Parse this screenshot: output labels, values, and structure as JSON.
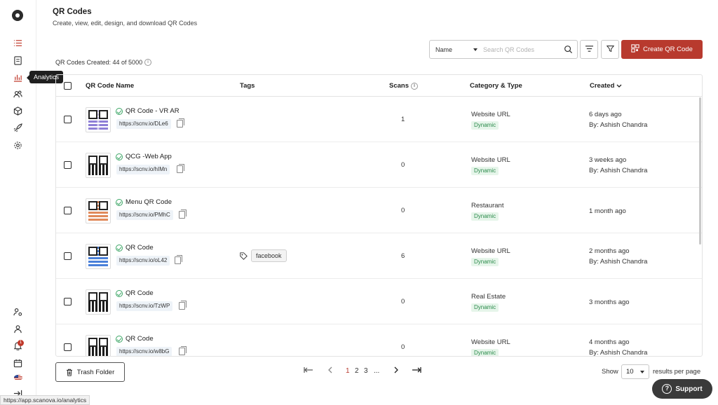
{
  "header": {
    "title": "QR Codes",
    "subtitle": "Create, view, edit, design, and download QR Codes",
    "counter": "QR Codes Created: 44 of 5000"
  },
  "sidebar": {
    "tooltip": "Analytics",
    "notification_count": "1"
  },
  "toolbar": {
    "filter_select_value": "Name",
    "search_placeholder": "Search QR Codes",
    "create_label": "Create QR Code"
  },
  "table": {
    "headers": {
      "name": "QR Code Name",
      "tags": "Tags",
      "scans": "Scans",
      "category": "Category & Type",
      "created": "Created"
    },
    "rows": [
      {
        "name": "QR Code - VR AR",
        "url": "https://scnv.io/DLe6",
        "tag": "",
        "scans": "1",
        "category": "Website URL",
        "type": "Dynamic",
        "created": "6 days ago",
        "by": "By: Ashish Chandra",
        "qr_style": "color"
      },
      {
        "name": "QCG -Web App",
        "url": "https://scnv.io/hIMn",
        "tag": "",
        "scans": "0",
        "category": "Website URL",
        "type": "Dynamic",
        "created": "3 weeks ago",
        "by": "By: Ashish Chandra",
        "qr_style": "bw"
      },
      {
        "name": "Menu QR Code",
        "url": "https://scnv.io/PMhC",
        "tag": "",
        "scans": "0",
        "category": "Restaurant",
        "type": "Dynamic",
        "created": "1 month ago",
        "by": "",
        "qr_style": "menu"
      },
      {
        "name": "QR Code",
        "url": "https://scnv.io/oL42",
        "tag": "facebook",
        "scans": "6",
        "category": "Website URL",
        "type": "Dynamic",
        "created": "2 months ago",
        "by": "By: Ashish Chandra",
        "qr_style": "blue"
      },
      {
        "name": "QR Code",
        "url": "https://scnv.io/TzWP",
        "tag": "",
        "scans": "0",
        "category": "Real Estate",
        "type": "Dynamic",
        "created": "3 months ago",
        "by": "",
        "qr_style": "bw"
      },
      {
        "name": "QR Code",
        "url": "https://scnv.io/w8bG",
        "tag": "",
        "scans": "0",
        "category": "Website URL",
        "type": "Dynamic",
        "created": "4 months ago",
        "by": "By: Ashish Chandra",
        "qr_style": "bw"
      }
    ]
  },
  "footer": {
    "trash_label": "Trash Folder",
    "pages": [
      "1",
      "2",
      "3",
      "..."
    ],
    "show_label": "Show",
    "per_page_value": "10",
    "per_page_label": "results per page"
  },
  "support_label": "Support",
  "status_url": "https://app.scanova.io/analytics",
  "colors": {
    "accent": "#b83a2e",
    "dynamic_bg": "#e6f5ea",
    "dynamic_text": "#2a8a4a"
  }
}
